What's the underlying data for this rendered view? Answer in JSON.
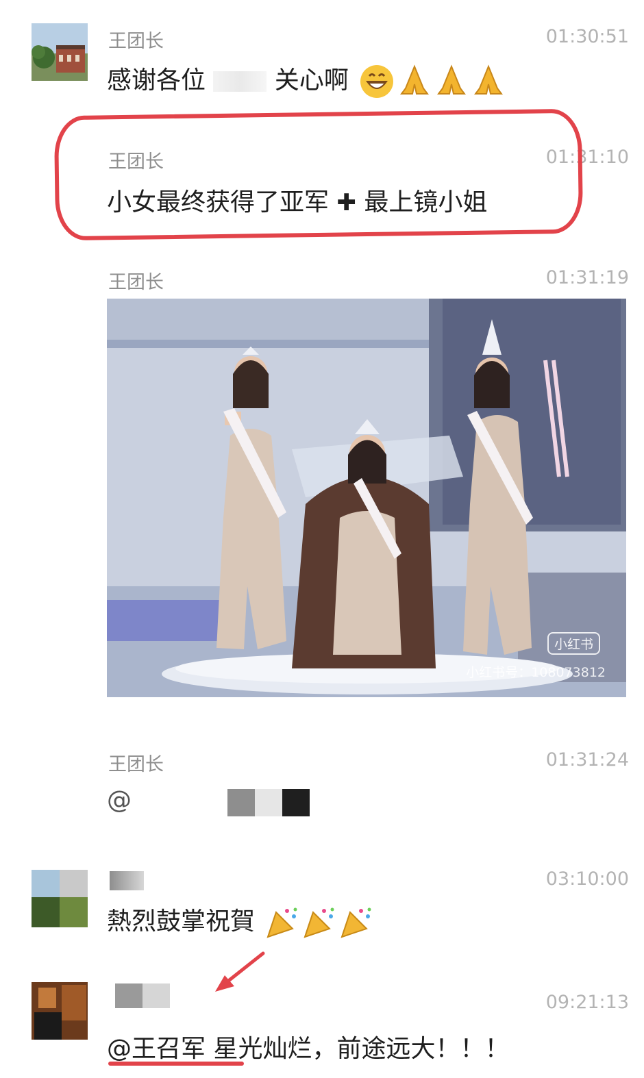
{
  "messages": [
    {
      "sender": "王团长",
      "time": "01:30:51",
      "text": "感谢各位",
      "text2": "关心啊"
    },
    {
      "sender": "王团长",
      "time": "01:31:10",
      "text": "小女最终获得了亚军",
      "plus": "✚",
      "text2": "最上镜小姐"
    },
    {
      "sender": "王团长",
      "time": "01:31:19",
      "image": {
        "watermark_logo": "小红书",
        "watermark_text": "小红书号：108073812"
      }
    },
    {
      "sender": "王团长",
      "time": "01:31:24",
      "text": "@"
    },
    {
      "time": "03:10:00",
      "text": "熱烈鼓掌祝賀"
    },
    {
      "time": "09:21:13",
      "text": "@王召军 星光灿烂，前途远大！！！"
    }
  ],
  "icons": {
    "grin": "grinning-face-icon",
    "pray": "praying-hands-icon",
    "party": "party-popper-icon",
    "arrow": "red-arrow-annotation"
  },
  "colors": {
    "annotation": "#e2434a",
    "sender": "#8e8e8e",
    "time": "#b3b3b3"
  }
}
